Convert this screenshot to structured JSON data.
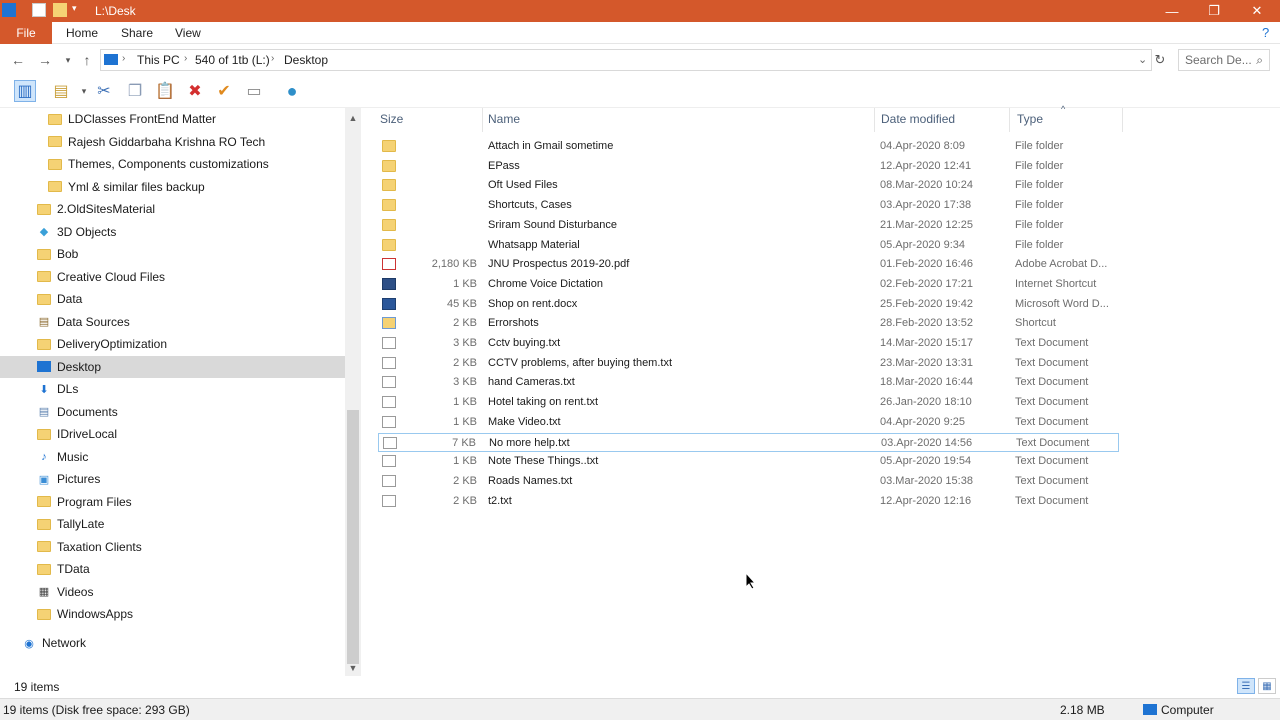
{
  "window": {
    "title": "L:\\Desk",
    "controls": {
      "minimize": "—",
      "restore": "❐",
      "close": "✕"
    }
  },
  "ribbon": {
    "file_label": "File",
    "tabs": [
      "Home",
      "Share",
      "View"
    ]
  },
  "address": {
    "crumbs": [
      "This PC",
      "540 of 1tb (L:)",
      "Desktop"
    ],
    "search_placeholder": "Search De..."
  },
  "nav_tree": [
    {
      "label": "LDClasses FrontEnd Matter",
      "icon": "folder-icon",
      "indent": 2
    },
    {
      "label": "Rajesh Giddarbaha Krishna RO Tech",
      "icon": "folder-icon",
      "indent": 2
    },
    {
      "label": "Themes, Components customizations",
      "icon": "folder-icon",
      "indent": 2
    },
    {
      "label": "Yml & similar files backup",
      "icon": "folder-icon",
      "indent": 2
    },
    {
      "label": "2.OldSitesMaterial",
      "icon": "folder-icon",
      "indent": 1
    },
    {
      "label": "3D Objects",
      "icon": "cube-icon",
      "indent": 1
    },
    {
      "label": "Bob",
      "icon": "folder-icon",
      "indent": 1
    },
    {
      "label": "Creative Cloud Files",
      "icon": "folder-icon",
      "indent": 1
    },
    {
      "label": "Data",
      "icon": "folder-icon",
      "indent": 1
    },
    {
      "label": "Data Sources",
      "icon": "database-icon",
      "indent": 1
    },
    {
      "label": "DeliveryOptimization",
      "icon": "folder-icon",
      "indent": 1
    },
    {
      "label": "Desktop",
      "icon": "desktop-icon",
      "indent": 1,
      "selected": true
    },
    {
      "label": "DLs",
      "icon": "download-icon",
      "indent": 1
    },
    {
      "label": "Documents",
      "icon": "documents-icon",
      "indent": 1
    },
    {
      "label": "IDriveLocal",
      "icon": "folder-icon",
      "indent": 1
    },
    {
      "label": "Music",
      "icon": "music-icon",
      "indent": 1
    },
    {
      "label": "Pictures",
      "icon": "pictures-icon",
      "indent": 1
    },
    {
      "label": "Program Files",
      "icon": "folder-icon",
      "indent": 1
    },
    {
      "label": "TallyLate",
      "icon": "folder-icon",
      "indent": 1
    },
    {
      "label": "Taxation Clients",
      "icon": "folder-icon",
      "indent": 1
    },
    {
      "label": "TData",
      "icon": "folder-icon",
      "indent": 1
    },
    {
      "label": "Videos",
      "icon": "videos-icon",
      "indent": 1
    },
    {
      "label": "WindowsApps",
      "icon": "folder-icon",
      "indent": 1
    },
    {
      "label": "Network",
      "icon": "network-icon",
      "indent": 0
    }
  ],
  "columns": {
    "size": "Size",
    "name": "Name",
    "date": "Date modified",
    "type": "Type"
  },
  "files": [
    {
      "size": "",
      "name": "Attach in Gmail sometime",
      "date": "04.Apr-2020 8:09",
      "type": "File folder",
      "kind": "folder"
    },
    {
      "size": "",
      "name": "EPass",
      "date": "12.Apr-2020 12:41",
      "type": "File folder",
      "kind": "folder"
    },
    {
      "size": "",
      "name": "Oft Used Files",
      "date": "08.Mar-2020 10:24",
      "type": "File folder",
      "kind": "folder"
    },
    {
      "size": "",
      "name": "Shortcuts, Cases",
      "date": "03.Apr-2020 17:38",
      "type": "File folder",
      "kind": "folder"
    },
    {
      "size": "",
      "name": "Sriram Sound Disturbance",
      "date": "21.Mar-2020 12:25",
      "type": "File folder",
      "kind": "folder"
    },
    {
      "size": "",
      "name": "Whatsapp Material",
      "date": "05.Apr-2020 9:34",
      "type": "File folder",
      "kind": "folder"
    },
    {
      "size": "2,180 KB",
      "name": "JNU Prospectus 2019-20.pdf",
      "date": "01.Feb-2020 16:46",
      "type": "Adobe Acrobat D...",
      "kind": "pdf"
    },
    {
      "size": "1 KB",
      "name": "Chrome Voice Dictation",
      "date": "02.Feb-2020 17:21",
      "type": "Internet Shortcut",
      "kind": "url"
    },
    {
      "size": "45 KB",
      "name": "Shop on rent.docx",
      "date": "25.Feb-2020 19:42",
      "type": "Microsoft Word D...",
      "kind": "word"
    },
    {
      "size": "2 KB",
      "name": "Errorshots",
      "date": "28.Feb-2020 13:52",
      "type": "Shortcut",
      "kind": "lnk"
    },
    {
      "size": "3 KB",
      "name": "Cctv buying.txt",
      "date": "14.Mar-2020 15:17",
      "type": "Text Document",
      "kind": "txt"
    },
    {
      "size": "2 KB",
      "name": "CCTV problems, after buying them.txt",
      "date": "23.Mar-2020 13:31",
      "type": "Text Document",
      "kind": "txt"
    },
    {
      "size": "3 KB",
      "name": "hand Cameras.txt",
      "date": "18.Mar-2020 16:44",
      "type": "Text Document",
      "kind": "txt"
    },
    {
      "size": "1 KB",
      "name": "Hotel taking on rent.txt",
      "date": "26.Jan-2020 18:10",
      "type": "Text Document",
      "kind": "txt"
    },
    {
      "size": "1 KB",
      "name": "Make Video.txt",
      "date": "04.Apr-2020 9:25",
      "type": "Text Document",
      "kind": "txt"
    },
    {
      "size": "7 KB",
      "name": "No more help.txt",
      "date": "03.Apr-2020 14:56",
      "type": "Text Document",
      "kind": "txt",
      "focused": true
    },
    {
      "size": "1 KB",
      "name": "Note These Things..txt",
      "date": "05.Apr-2020 19:54",
      "type": "Text Document",
      "kind": "txt"
    },
    {
      "size": "2 KB",
      "name": "Roads Names.txt",
      "date": "03.Mar-2020 15:38",
      "type": "Text Document",
      "kind": "txt"
    },
    {
      "size": "2 KB",
      "name": "t2.txt",
      "date": "12.Apr-2020 12:16",
      "type": "Text Document",
      "kind": "txt"
    }
  ],
  "status": {
    "items_count": "19 items"
  },
  "details_bar": {
    "left": "19 items (Disk free space: 293 GB)",
    "size": "2.18 MB",
    "location": "Computer"
  },
  "colors": {
    "accent": "#d4582b",
    "selected": "#d9d9d9",
    "focus": "#99c9ef"
  }
}
